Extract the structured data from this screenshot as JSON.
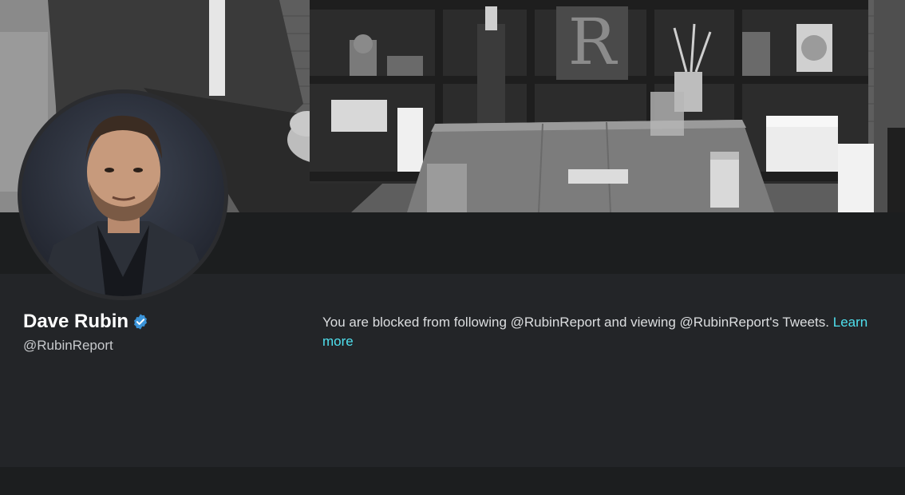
{
  "profile": {
    "display_name": "Dave Rubin",
    "handle": "@RubinReport",
    "verified": true,
    "verified_color": "#3b94d9"
  },
  "blocked_notice": {
    "message": "You are blocked from following @RubinReport and viewing @RubinReport's Tweets.",
    "link_label": "Learn more",
    "link_color": "#4fe0ee"
  },
  "icons": {
    "verified": "verified-badge-icon"
  },
  "colors": {
    "page_background": "#1c1e1f",
    "card_background": "#232528",
    "name_color": "#ffffff",
    "handle_color": "#c7c9cc"
  }
}
